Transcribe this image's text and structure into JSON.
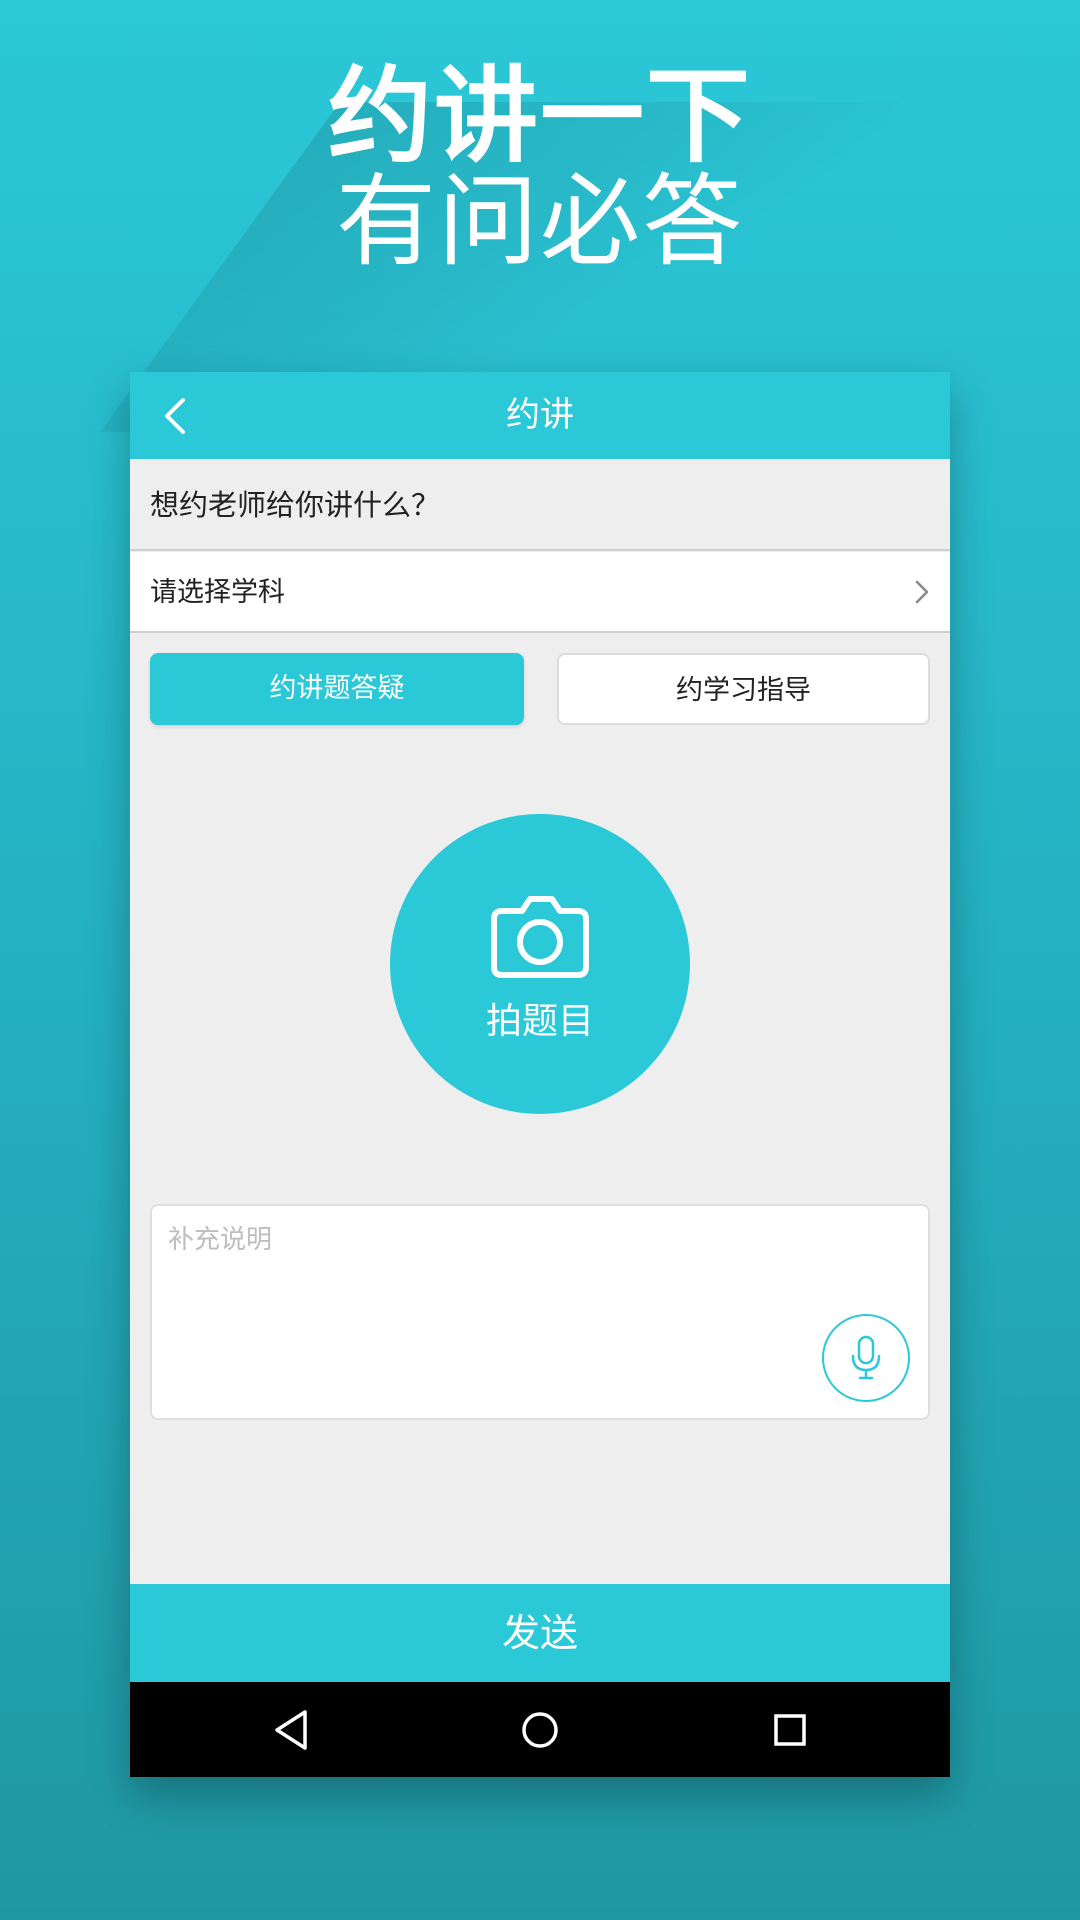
{
  "promo": {
    "line1": "约讲一下",
    "line2": "有问必答"
  },
  "app": {
    "title": "约讲",
    "back_icon": "chevron-left-icon",
    "question": "想约老师给你讲什么？",
    "subject_picker": {
      "label": "请选择学科",
      "icon": "chevron-right-icon"
    },
    "tabs": [
      {
        "label": "约讲题答疑",
        "active": true
      },
      {
        "label": "约学习指导",
        "active": false
      }
    ],
    "photo_button": {
      "label": "拍题目",
      "icon": "camera-icon"
    },
    "description": {
      "placeholder": "补充说明",
      "value": "",
      "voice_icon": "microphone-icon"
    },
    "send_label": "发送"
  },
  "navbar": {
    "back_icon": "triangle-back-icon",
    "home_icon": "circle-home-icon",
    "recent_icon": "square-recent-icon"
  },
  "colors": {
    "accent": "#2bc8d8",
    "background_gradient_top": "#2bc8d8",
    "background_gradient_bottom": "#1f97a3",
    "screen_bg": "#eeeeee",
    "navbar_bg": "#000000"
  }
}
